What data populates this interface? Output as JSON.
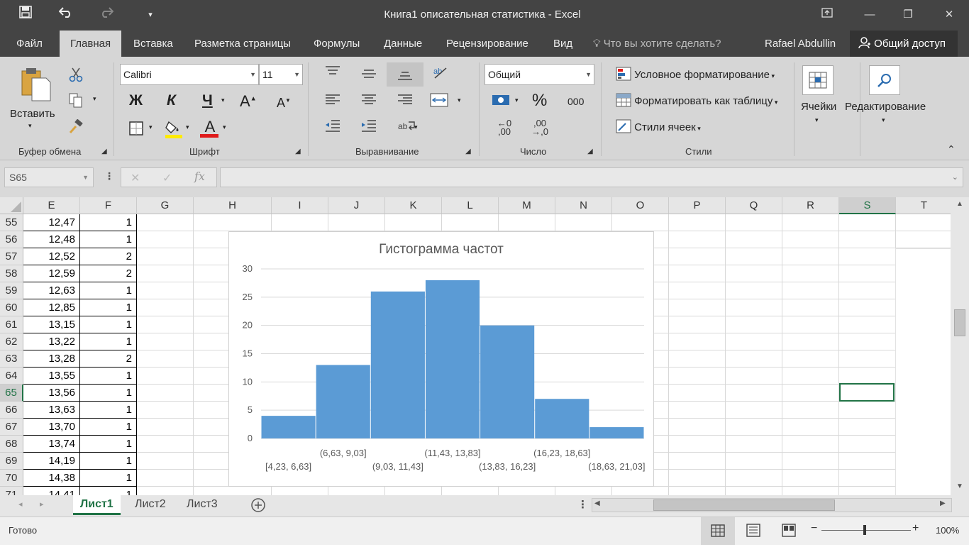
{
  "window": {
    "title": "Книга1 описательная статистика - Excel",
    "minimize": "—",
    "restore": "❐",
    "close": "✕"
  },
  "quick_access": {
    "save_icon": "save-icon",
    "undo_icon": "undo-icon",
    "redo_icon": "redo-icon",
    "customize_icon": "customize-icon"
  },
  "tabs": [
    "Файл",
    "Главная",
    "Вставка",
    "Разметка страницы",
    "Формулы",
    "Данные",
    "Рецензирование",
    "Вид"
  ],
  "active_tab": "Главная",
  "tell_me": "Что вы хотите сделать?",
  "user": "Rafael Abdullin",
  "share": "Общий доступ",
  "ribbon": {
    "clipboard": {
      "label": "Буфер обмена",
      "paste": "Вставить"
    },
    "font": {
      "label": "Шрифт",
      "family": "Calibri",
      "size": "11",
      "bold": "Ж",
      "italic": "К",
      "underline": "Ч",
      "grow": "A",
      "shrink": "A",
      "font_color_letter": "A"
    },
    "alignment": {
      "label": "Выравнивание"
    },
    "number": {
      "label": "Число",
      "format": "Общий",
      "percent": "%",
      "thousands": "000",
      "inc_decimal_top": "←0",
      "inc_decimal_bottom": ",00",
      "dec_decimal_top": ",00",
      "dec_decimal_bottom": "→,0"
    },
    "styles": {
      "label": "Стили",
      "conditional": "Условное форматирование",
      "as_table": "Форматировать как таблицу",
      "cell_styles": "Стили ячеек"
    },
    "cells": {
      "label": "Ячейки"
    },
    "editing": {
      "label": "Редактирование"
    }
  },
  "formula_bar": {
    "name_box": "S65",
    "cancel": "✕",
    "enter": "✓",
    "fx": "fx",
    "value": ""
  },
  "columns": [
    "E",
    "F",
    "G",
    "H",
    "I",
    "J",
    "K",
    "L",
    "M",
    "N",
    "O",
    "P",
    "Q",
    "R",
    "S",
    "T"
  ],
  "selected_column": "S",
  "rows": [
    {
      "n": "55",
      "e": "12,47",
      "f": "1"
    },
    {
      "n": "56",
      "e": "12,48",
      "f": "1"
    },
    {
      "n": "57",
      "e": "12,52",
      "f": "2"
    },
    {
      "n": "58",
      "e": "12,59",
      "f": "2"
    },
    {
      "n": "59",
      "e": "12,63",
      "f": "1"
    },
    {
      "n": "60",
      "e": "12,85",
      "f": "1"
    },
    {
      "n": "61",
      "e": "13,15",
      "f": "1"
    },
    {
      "n": "62",
      "e": "13,22",
      "f": "1"
    },
    {
      "n": "63",
      "e": "13,28",
      "f": "2"
    },
    {
      "n": "64",
      "e": "13,55",
      "f": "1"
    },
    {
      "n": "65",
      "e": "13,56",
      "f": "1"
    },
    {
      "n": "66",
      "e": "13,63",
      "f": "1"
    },
    {
      "n": "67",
      "e": "13,70",
      "f": "1"
    },
    {
      "n": "68",
      "e": "13,74",
      "f": "1"
    },
    {
      "n": "69",
      "e": "14,19",
      "f": "1"
    },
    {
      "n": "70",
      "e": "14,38",
      "f": "1"
    },
    {
      "n": "71",
      "e": "14,41",
      "f": "1"
    }
  ],
  "selected_row": "65",
  "chart_data": {
    "type": "bar",
    "title": "Гистограмма частот",
    "categories": [
      "[4,23, 6,63]",
      "(6,63, 9,03]",
      "(9,03, 11,43]",
      "(11,43, 13,83]",
      "(13,83, 16,23]",
      "(16,23, 18,63]",
      "(18,63, 21,03]"
    ],
    "values": [
      4,
      13,
      26,
      28,
      20,
      7,
      2
    ],
    "yticks": [
      "0",
      "5",
      "10",
      "15",
      "20",
      "25",
      "30"
    ],
    "ylim": [
      0,
      30
    ],
    "grid": true,
    "bar_color": "#5b9bd5"
  },
  "sheets": [
    "Лист1",
    "Лист2",
    "Лист3"
  ],
  "active_sheet": "Лист1",
  "status": {
    "ready": "Готово",
    "zoom": "100%",
    "zoom_minus": "−",
    "zoom_plus": "+"
  },
  "colors": {
    "excel_green": "#217346",
    "title_bg": "#444444",
    "ribbon_bg": "#d6d6d6"
  }
}
